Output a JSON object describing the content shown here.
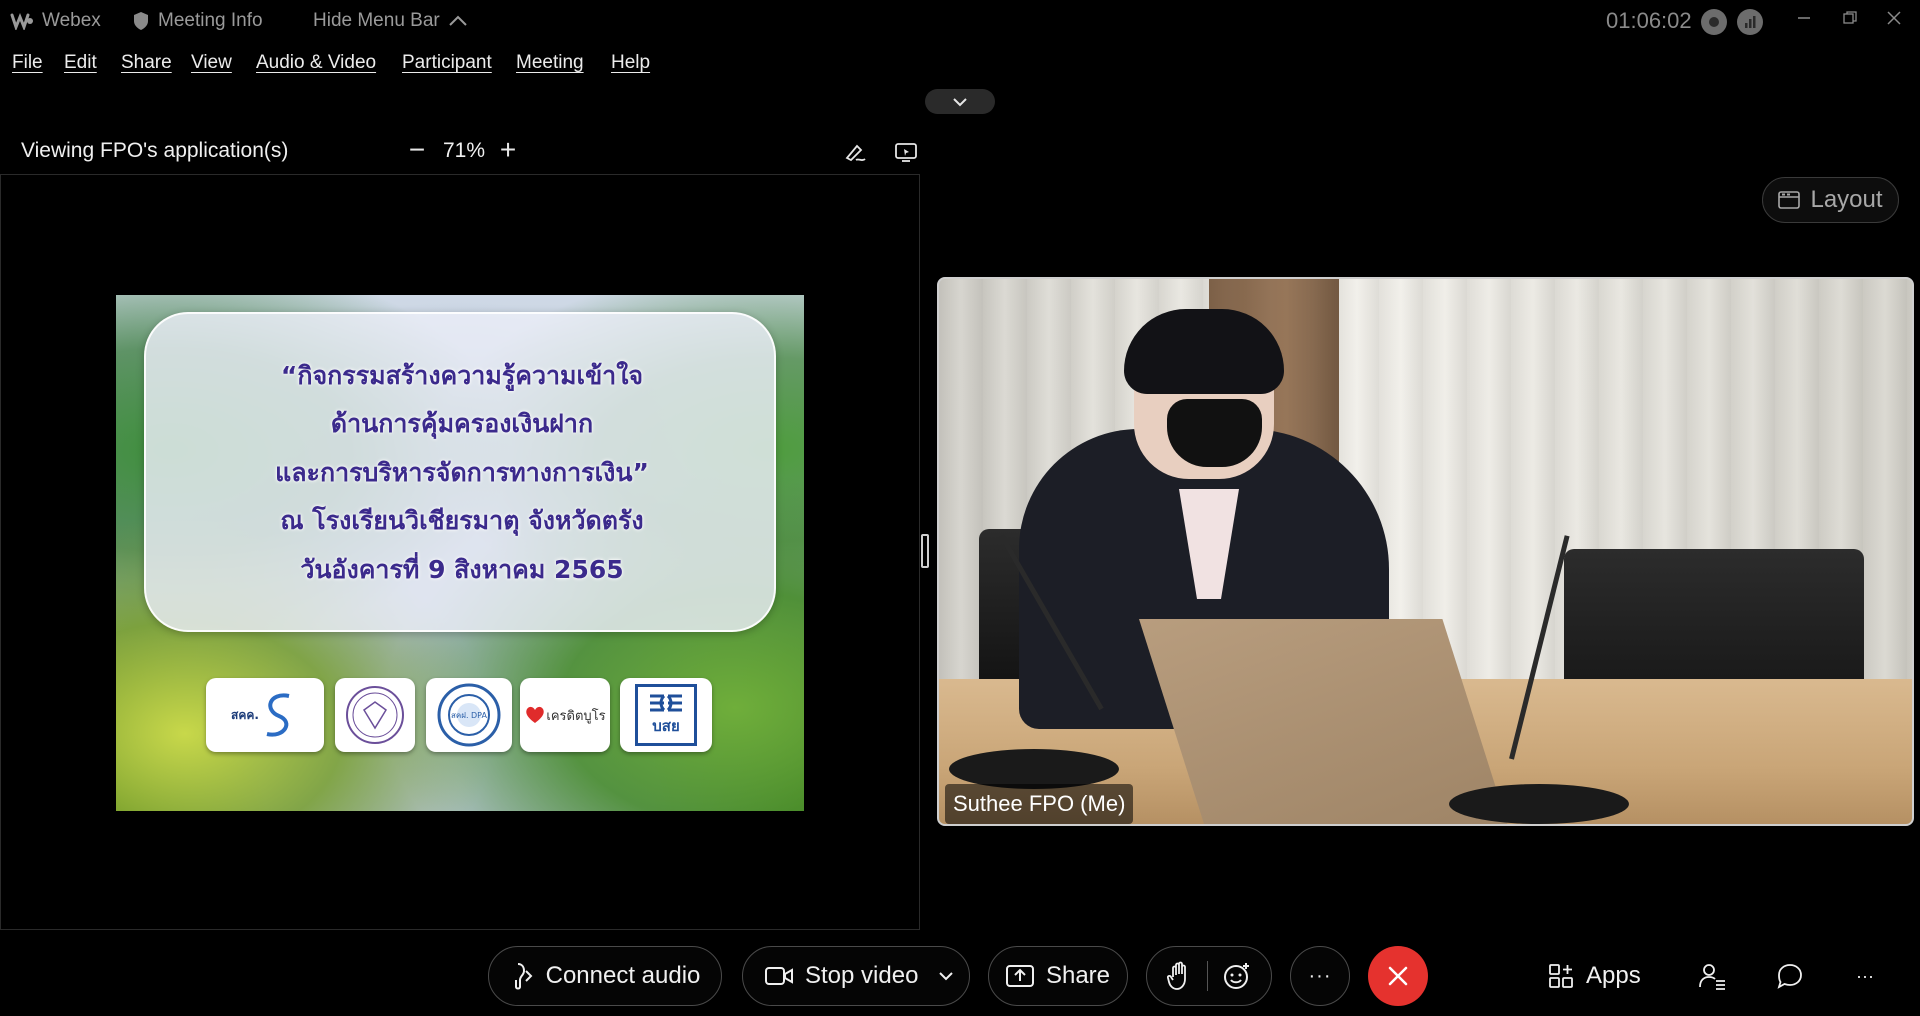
{
  "titlebar": {
    "app_name": "Webex",
    "meeting_info": "Meeting Info",
    "hide_menu_bar": "Hide Menu Bar",
    "timer": "01:06:02"
  },
  "menu": {
    "items": [
      "File",
      "Edit",
      "Share",
      "View",
      "Audio & Video",
      "Participant",
      "Meeting",
      "Help"
    ]
  },
  "share": {
    "viewing_label": "Viewing FPO's application(s)",
    "zoom_level": "71%",
    "zoom_out": "−",
    "zoom_in": "+"
  },
  "slide": {
    "lines": [
      "“กิจกรรมสร้างความรู้ความเข้าใจ",
      "ด้านการคุ้มครองเงินฝาก",
      "และการบริหารจัดการทางการเงิน”",
      "ณ โรงเรียนวิเชียรมาตุ จังหวัดตรัง",
      "วันอังคารที่ 9 สิงหาคม 2565"
    ],
    "logos": [
      "สคค.",
      "",
      "สคฝ. DPA",
      "เครดิตบูโร",
      "บสย"
    ]
  },
  "layout_button": {
    "label": "Layout"
  },
  "video": {
    "participant_name": "Suthee FPO (Me)"
  },
  "controls": {
    "connect_audio": "Connect audio",
    "stop_video": "Stop video",
    "share": "Share",
    "more": "···",
    "apps": "Apps",
    "overflow": "···"
  },
  "colors": {
    "end_call": "#e5322e",
    "slide_text": "#3b2a8c",
    "background": "#000000"
  }
}
